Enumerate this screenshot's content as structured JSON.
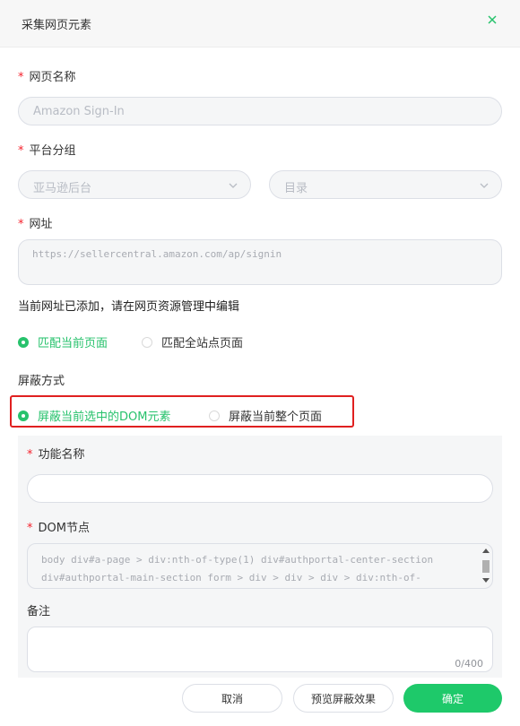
{
  "dialog": {
    "title": "采集网页元素"
  },
  "form": {
    "page_name": {
      "label": "网页名称",
      "value": "Amazon Sign-In"
    },
    "platform_group": {
      "label": "平台分组",
      "platform": "亚马逊后台",
      "catalog": "目录"
    },
    "url": {
      "label": "网址",
      "value": "https://sellercentral.amazon.com/ap/signin"
    },
    "url_note": "当前网址已添加，请在网页资源管理中编辑",
    "match": {
      "current": "匹配当前页面",
      "all": "匹配全站点页面"
    },
    "block": {
      "label": "屏蔽方式",
      "option_element": "屏蔽当前选中的DOM元素",
      "option_page": "屏蔽当前整个页面"
    },
    "feature_name": {
      "label": "功能名称",
      "value": ""
    },
    "dom_node": {
      "label": "DOM节点",
      "line1": "body div#a-page > div:nth-of-type(1) div#authportal-center-section",
      "line2": "div#authportal-main-section form > div > div > div > div:nth-of-"
    },
    "remark": {
      "label": "备注",
      "value": "",
      "counter": "0/400"
    }
  },
  "footer": {
    "cancel": "取消",
    "preview": "预览屏蔽效果",
    "confirm": "确定"
  },
  "colors": {
    "accent": "#1ec96a",
    "highlight": "#e02020",
    "required": "#f5222d"
  },
  "icons": {
    "close": "close-icon",
    "dropdown": "chevron-down-icon"
  }
}
